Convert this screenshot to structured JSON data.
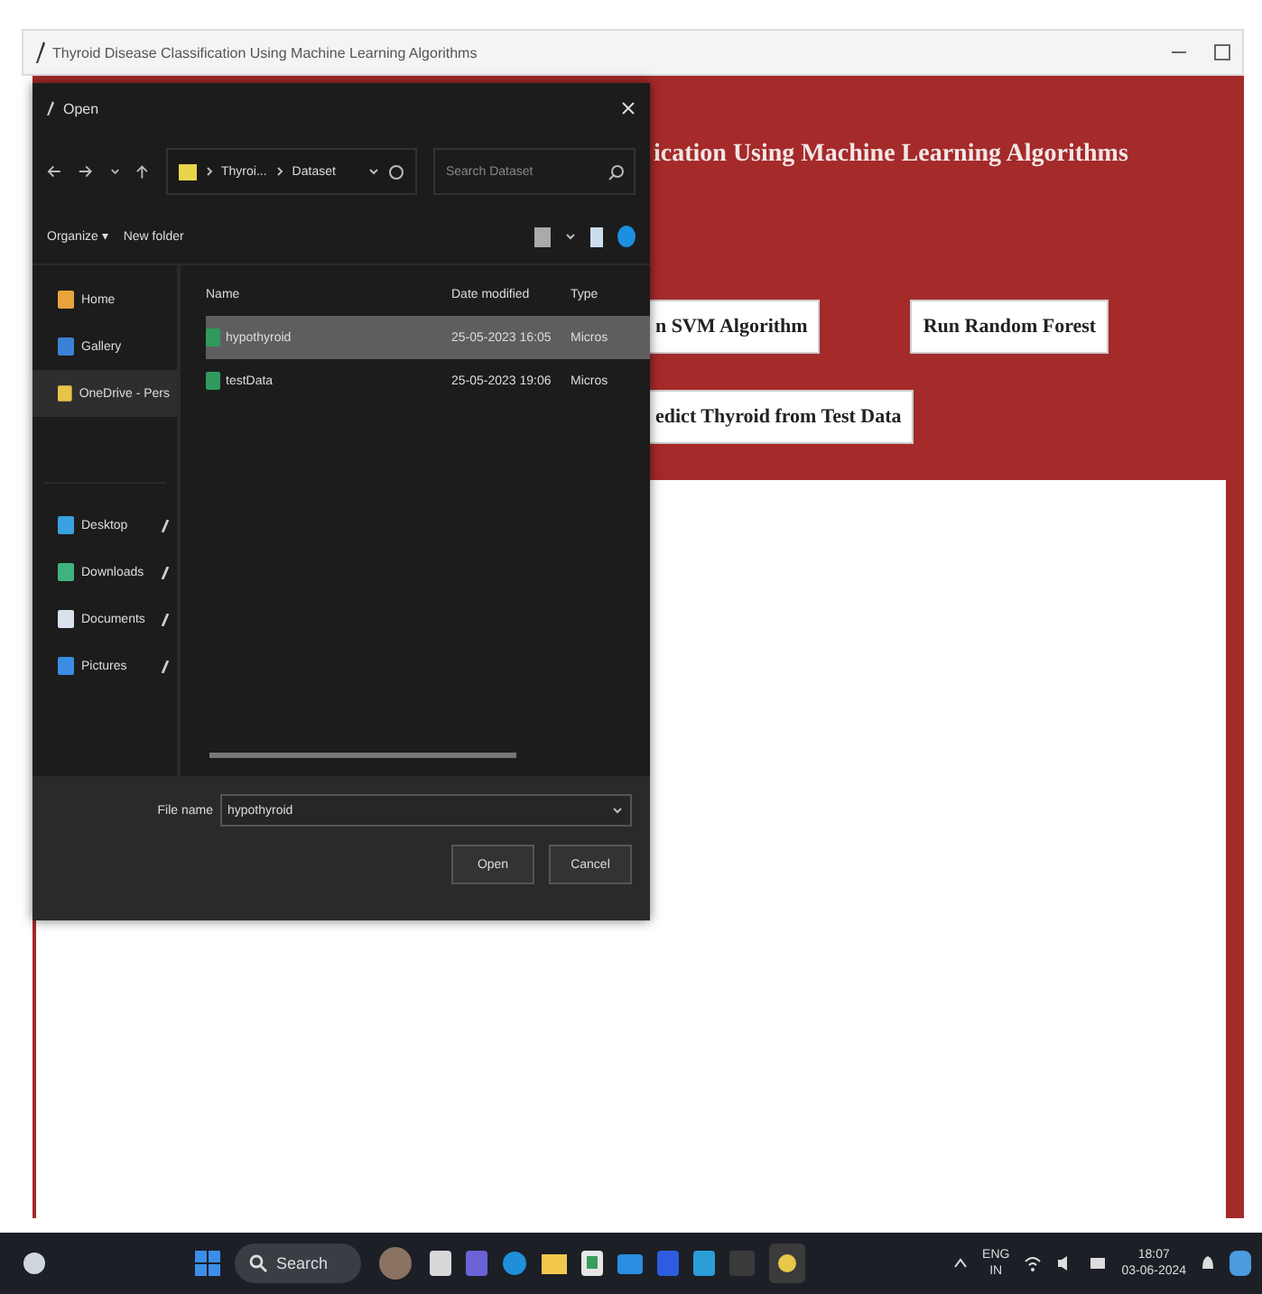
{
  "window": {
    "title": "Thyroid Disease Classification Using Machine Learning Algorithms"
  },
  "app": {
    "heading": "ication Using Machine Learning Algorithms",
    "buttons": [
      {
        "label": "n SVM Algorithm"
      },
      {
        "label": "Run Random Forest"
      },
      {
        "label": "edict Thyroid from Test Data"
      }
    ]
  },
  "dialog": {
    "title": "Open",
    "path": [
      "Thyroi...",
      "Dataset"
    ],
    "search": {
      "placeholder": "Search Dataset"
    },
    "toolbar": [
      "Organize ▾",
      "New folder"
    ],
    "sidebar": [
      {
        "label": "Home",
        "selected": false
      },
      {
        "label": "Gallery",
        "selected": false
      },
      {
        "label": "OneDrive - Pers",
        "selected": true
      },
      {
        "label": "Desktop",
        "selected": false
      },
      {
        "label": "Downloads",
        "selected": false
      },
      {
        "label": "Documents",
        "selected": false
      },
      {
        "label": "Pictures",
        "selected": false
      }
    ],
    "columns": [
      "Name",
      "Date modified",
      "Type"
    ],
    "files": [
      {
        "name": "hypothyroid",
        "date": "25-05-2023 16:05",
        "type": "Micros",
        "selected": true
      },
      {
        "name": "testData",
        "date": "25-05-2023 19:06",
        "type": "Micros",
        "selected": false
      }
    ],
    "file_name_label": "File name",
    "file_name": "hypothyroid",
    "buttons": [
      "Open",
      "Cancel"
    ]
  },
  "taskbar": {
    "search": "Search",
    "language": [
      "ENG",
      "IN"
    ],
    "time": "18:07",
    "date": "03-06-2024"
  }
}
